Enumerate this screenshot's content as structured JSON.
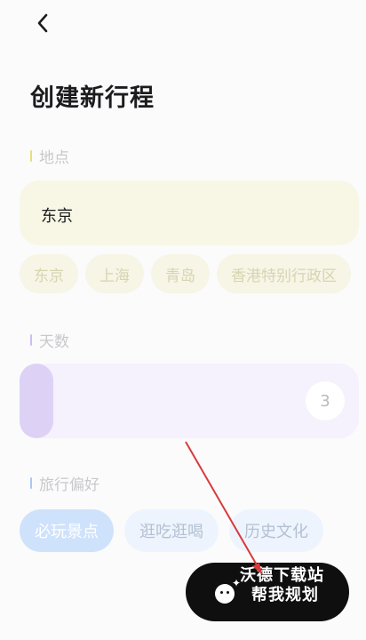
{
  "header": {
    "back_icon": "chevron-left-icon",
    "title": "创建新行程"
  },
  "location": {
    "label": "地点",
    "accent": "#e8df7a",
    "value": "东京",
    "suggestions": [
      "东京",
      "上海",
      "青岛",
      "香港特别行政区"
    ]
  },
  "days": {
    "label": "天数",
    "accent": "#cdbdf4",
    "value": "3"
  },
  "preferences": {
    "label": "旅行偏好",
    "accent": "#a9c8f5",
    "options": [
      {
        "label": "必玩景点",
        "selected": true
      },
      {
        "label": "逛吃逛喝",
        "selected": false
      },
      {
        "label": "历史文化",
        "selected": false
      }
    ]
  },
  "plan_button": {
    "label": "帮我规划",
    "icon": "ghost-face-icon"
  },
  "watermark": {
    "text": "沃德下载站"
  },
  "annotation": {
    "color": "#d83a3a"
  }
}
